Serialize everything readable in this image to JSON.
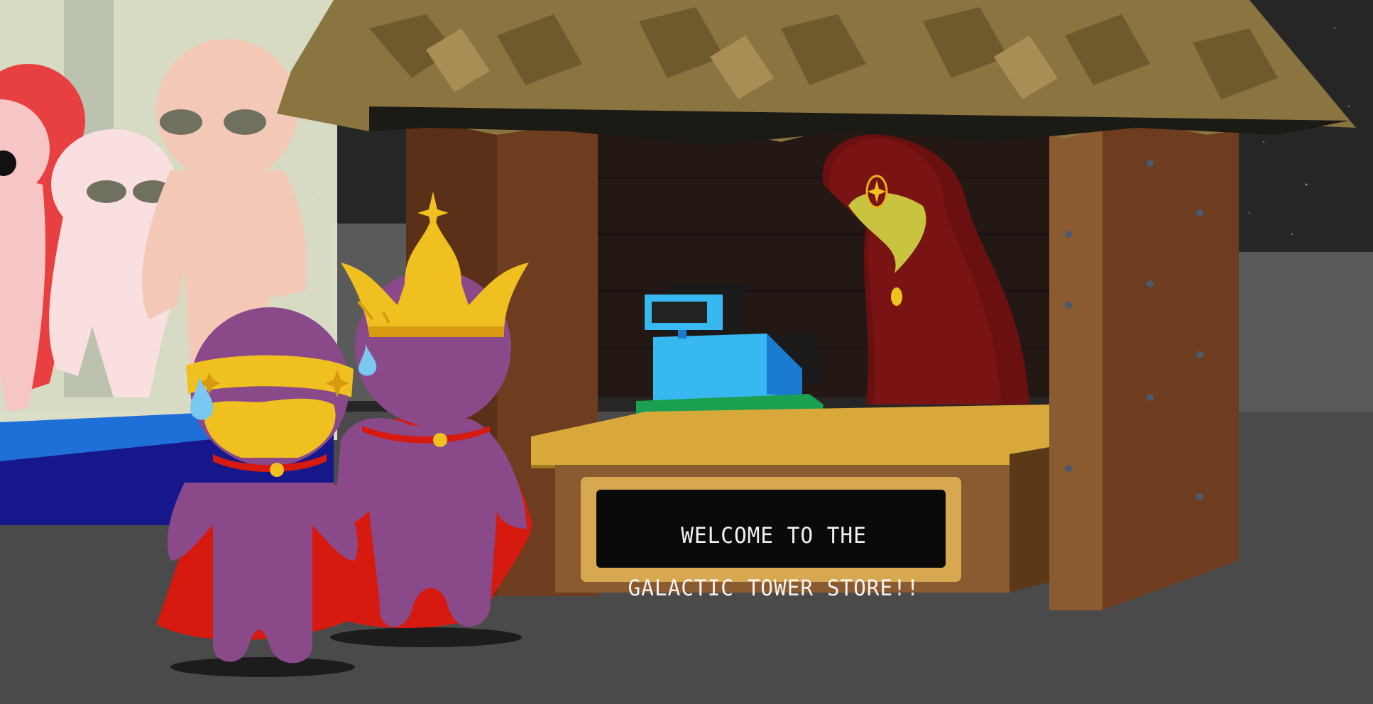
{
  "scene": {
    "sign": {
      "line1": "WELCOME TO THE",
      "line2": "GALACTIC TOWER STORE!!"
    }
  },
  "colors": {
    "space": "#262626",
    "floor": "#4a4a4a",
    "wall": "#5a5a5a",
    "roof": "#8a7440",
    "wood": "#8a5a30",
    "counter": "#d8a83a",
    "shopkeeper_robe": "#7a1414",
    "player_robe": "#8a4a8a",
    "cape": "#d61a10",
    "crown": "#f0c020",
    "register": "#38b8f0"
  }
}
